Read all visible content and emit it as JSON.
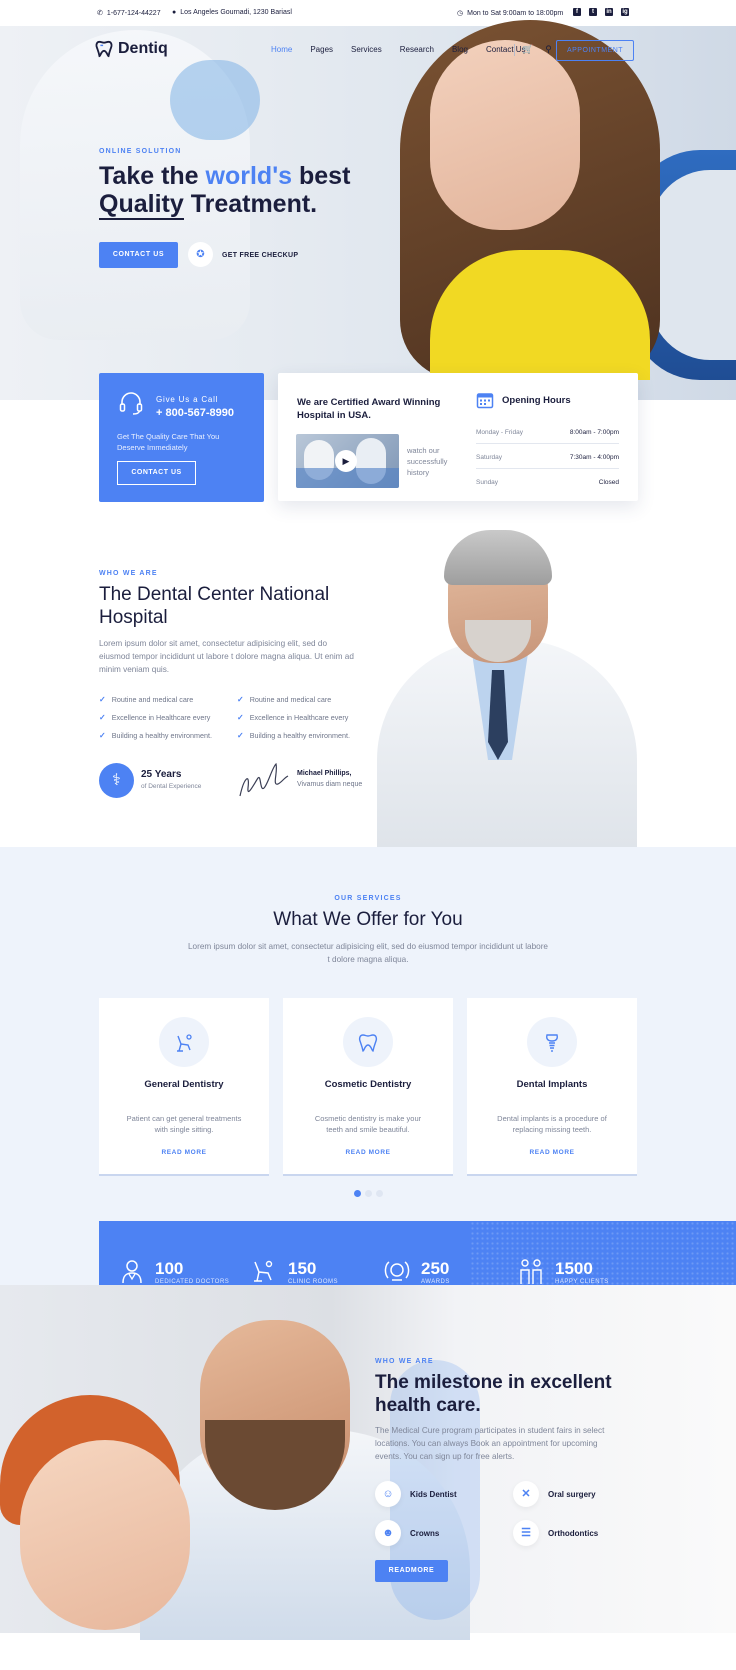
{
  "topbar": {
    "phone": "1-677-124-44227",
    "address": "Los Angeles Gournadi, 1230 Bariasl",
    "hours": "Mon to Sat 9:00am to 18:00pm",
    "socials": [
      "f",
      "t",
      "in",
      "ig"
    ]
  },
  "nav": {
    "logo": "Dentiq",
    "links": [
      "Home",
      "Pages",
      "Services",
      "Research",
      "Blog",
      "Contact Us"
    ],
    "active": "Home",
    "appointment": "APPOINTMENT"
  },
  "hero": {
    "eyebrow": "ONLINE SOLUTION",
    "title_part1": "Take the ",
    "title_highlight": "world's",
    "title_part2": " best",
    "title_underline": "Quality",
    "title_part3": " Treatment.",
    "contact_button": "CONTACT US",
    "checkup": "GET FREE CHECKUP"
  },
  "call_card": {
    "label": "Give Us a Call",
    "phone": "+ 800-567-8990",
    "description": "Get The Quality Care That You Deserve Immediately",
    "button": "CONTACT US"
  },
  "award": {
    "title": "We are Certified Award Winning Hospital in USA.",
    "watch": "watch our successfully history"
  },
  "opening_hours": {
    "title": "Opening Hours",
    "rows": [
      {
        "day": "Monday - Friday",
        "time": "8:00am - 7:00pm"
      },
      {
        "day": "Saturday",
        "time": "7:30am - 4:00pm"
      },
      {
        "day": "Sunday",
        "time": "Closed"
      }
    ]
  },
  "about": {
    "eyebrow": "WHO WE ARE",
    "title": "The Dental Center National Hospital",
    "text": "Lorem ipsum dolor sit amet, consectetur adipisicing elit, sed do eiusmod tempor incididunt ut labore t dolore magna aliqua. Ut enim ad minim veniam quis.",
    "checks_left": [
      "Routine and medical care",
      "Excellence in Healthcare every",
      "Building a healthy environment."
    ],
    "checks_right": [
      "Routine and medical care",
      "Excellence in Healthcare every",
      "Building a healthy environment."
    ],
    "years": "25 Years",
    "years_label": "of Dental Experience",
    "signer_name": "Michael Phillips,",
    "signer_role": "Vivamus diam neque"
  },
  "services": {
    "eyebrow": "OUR SERVICES",
    "title": "What We Offer for You",
    "subtitle": "Lorem ipsum dolor sit amet, consectetur adipisicing elit, sed do eiusmod tempor incididunt ut labore t dolore magna aliqua.",
    "cards": [
      {
        "name": "General Dentistry",
        "desc": "Patient can get general treatments with single sitting.",
        "more": "READ MORE",
        "icon": "dental-chair-icon"
      },
      {
        "name": "Cosmetic Dentistry",
        "desc": "Cosmetic dentistry is make your teeth and smile beautiful.",
        "more": "READ MORE",
        "icon": "tooth-icon"
      },
      {
        "name": "Dental Implants",
        "desc": "Dental implants is a procedure of replacing missing teeth.",
        "more": "READ MORE",
        "icon": "implant-icon"
      }
    ]
  },
  "stats": [
    {
      "number": "100",
      "label": "DEDICATED DOCTORS",
      "icon": "doctor-icon"
    },
    {
      "number": "150",
      "label": "CLINIC ROOMS",
      "icon": "dental-chair-icon"
    },
    {
      "number": "250",
      "label": "AWARDS",
      "icon": "award-icon"
    },
    {
      "number": "1500",
      "label": "HAPPY CLIENTS",
      "icon": "people-icon"
    }
  ],
  "milestone": {
    "eyebrow": "WHO WE ARE",
    "title": "The milestone in excellent health care.",
    "text": "The Medical Cure program participates in student fairs in select locations. You can always Book an appointment for upcoming events. You can sign up for free alerts.",
    "items": [
      "Kids Dentist",
      "Oral surgery",
      "Crowns",
      "Orthodontics"
    ],
    "button": "READMORE"
  },
  "colors": {
    "accent": "#4d82f3",
    "navy": "#1b1e3d",
    "muted": "#7f8699",
    "light_bg": "#eef3fb"
  }
}
